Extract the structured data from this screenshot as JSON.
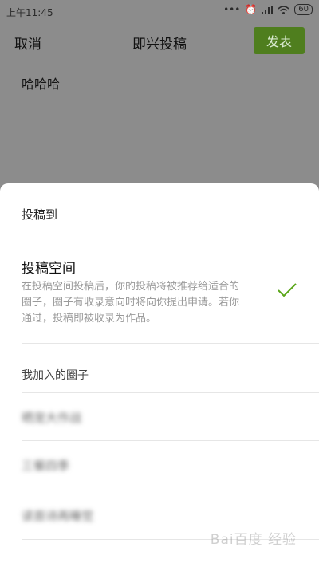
{
  "status_bar": {
    "time": "上午11:45",
    "battery": "60"
  },
  "nav": {
    "cancel_label": "取消",
    "title": "即兴投稿",
    "publish_label": "发表"
  },
  "draft": {
    "text": "哈哈哈"
  },
  "sheet": {
    "heading": "投稿到",
    "space_option": {
      "title": "投稿空间",
      "description": "在投稿空间投稿后，你的投稿将被推荐给适合的圈子，圈子有收录意向时将向你提出申请。若你通过，投稿即被收录为作品。"
    },
    "joined_heading": "我加入的圈子",
    "circles": [
      {
        "label": "晒宠大作战"
      },
      {
        "label": "三餐四季"
      },
      {
        "label": "读首诗再睡觉"
      }
    ]
  },
  "colors": {
    "accent": "#4f7e1e",
    "check": "#5aa619"
  },
  "watermark": "Bai百度 经验"
}
